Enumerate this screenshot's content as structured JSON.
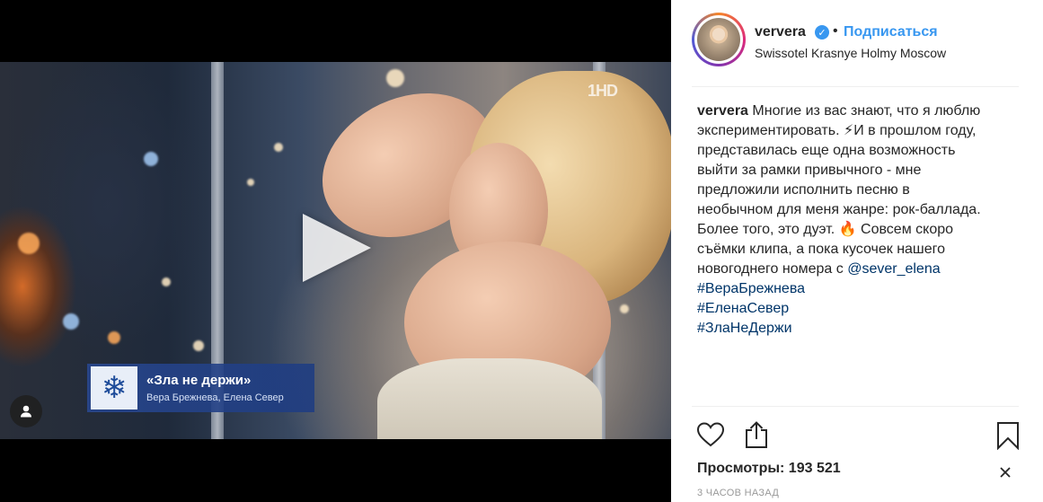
{
  "video": {
    "tv_logo": "1HD",
    "caption_title": "«Зла не держи»",
    "caption_subtitle": "Вера Брежнева, Елена Север"
  },
  "header": {
    "username": "ververa",
    "verified_symbol": "✓",
    "separator": "•",
    "follow_label": "Подписаться",
    "location": "Swissotel Krasnye Holmy Moscow"
  },
  "comment": {
    "author": "ververa",
    "lines": [
      "Многие из вас знают, что я люблю",
      "экспериментировать. ⚡И в прошлом году,",
      "представилась еще одна возможность",
      "выйти за рамки привычного - мне",
      "предложили исполнить песню в",
      "необычном для меня жанре: рок-баллада.",
      "Более того, это дуэт. 🔥 Совсем скоро",
      "съёмки клипа, а пока кусочек нашего",
      "новогоднего номера с "
    ],
    "mention": "@sever_elena",
    "hashtags": [
      "#ВераБрежнева",
      "#ЕленаСевер",
      "#ЗлаНеДержи"
    ]
  },
  "stats": {
    "views_label": "Просмотры:",
    "views_count": "193 521",
    "timestamp": "3 ЧАСОВ НАЗАД"
  },
  "icons": {
    "like": "heart-icon",
    "share": "share-icon",
    "save": "bookmark-icon",
    "tag": "user-tag-icon",
    "play": "play-icon",
    "more": "more-icon"
  },
  "colors": {
    "link_blue": "#3897f0",
    "mention_blue": "#003569",
    "text": "#262626",
    "muted": "#999999"
  }
}
